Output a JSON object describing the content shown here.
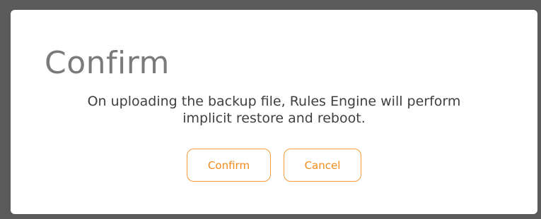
{
  "dialog": {
    "title": "Confirm",
    "message_line_1": "On uploading the backup file, Rules Engine will perform",
    "message_line_2": "implicit restore and reboot.",
    "confirm_label": "Confirm",
    "cancel_label": "Cancel"
  },
  "colors": {
    "overlay": "#5a5a5a",
    "dialog_background": "#ffffff",
    "title_text": "#7a7a7a",
    "message_text": "#404040",
    "button_accent": "#f08a1c"
  }
}
